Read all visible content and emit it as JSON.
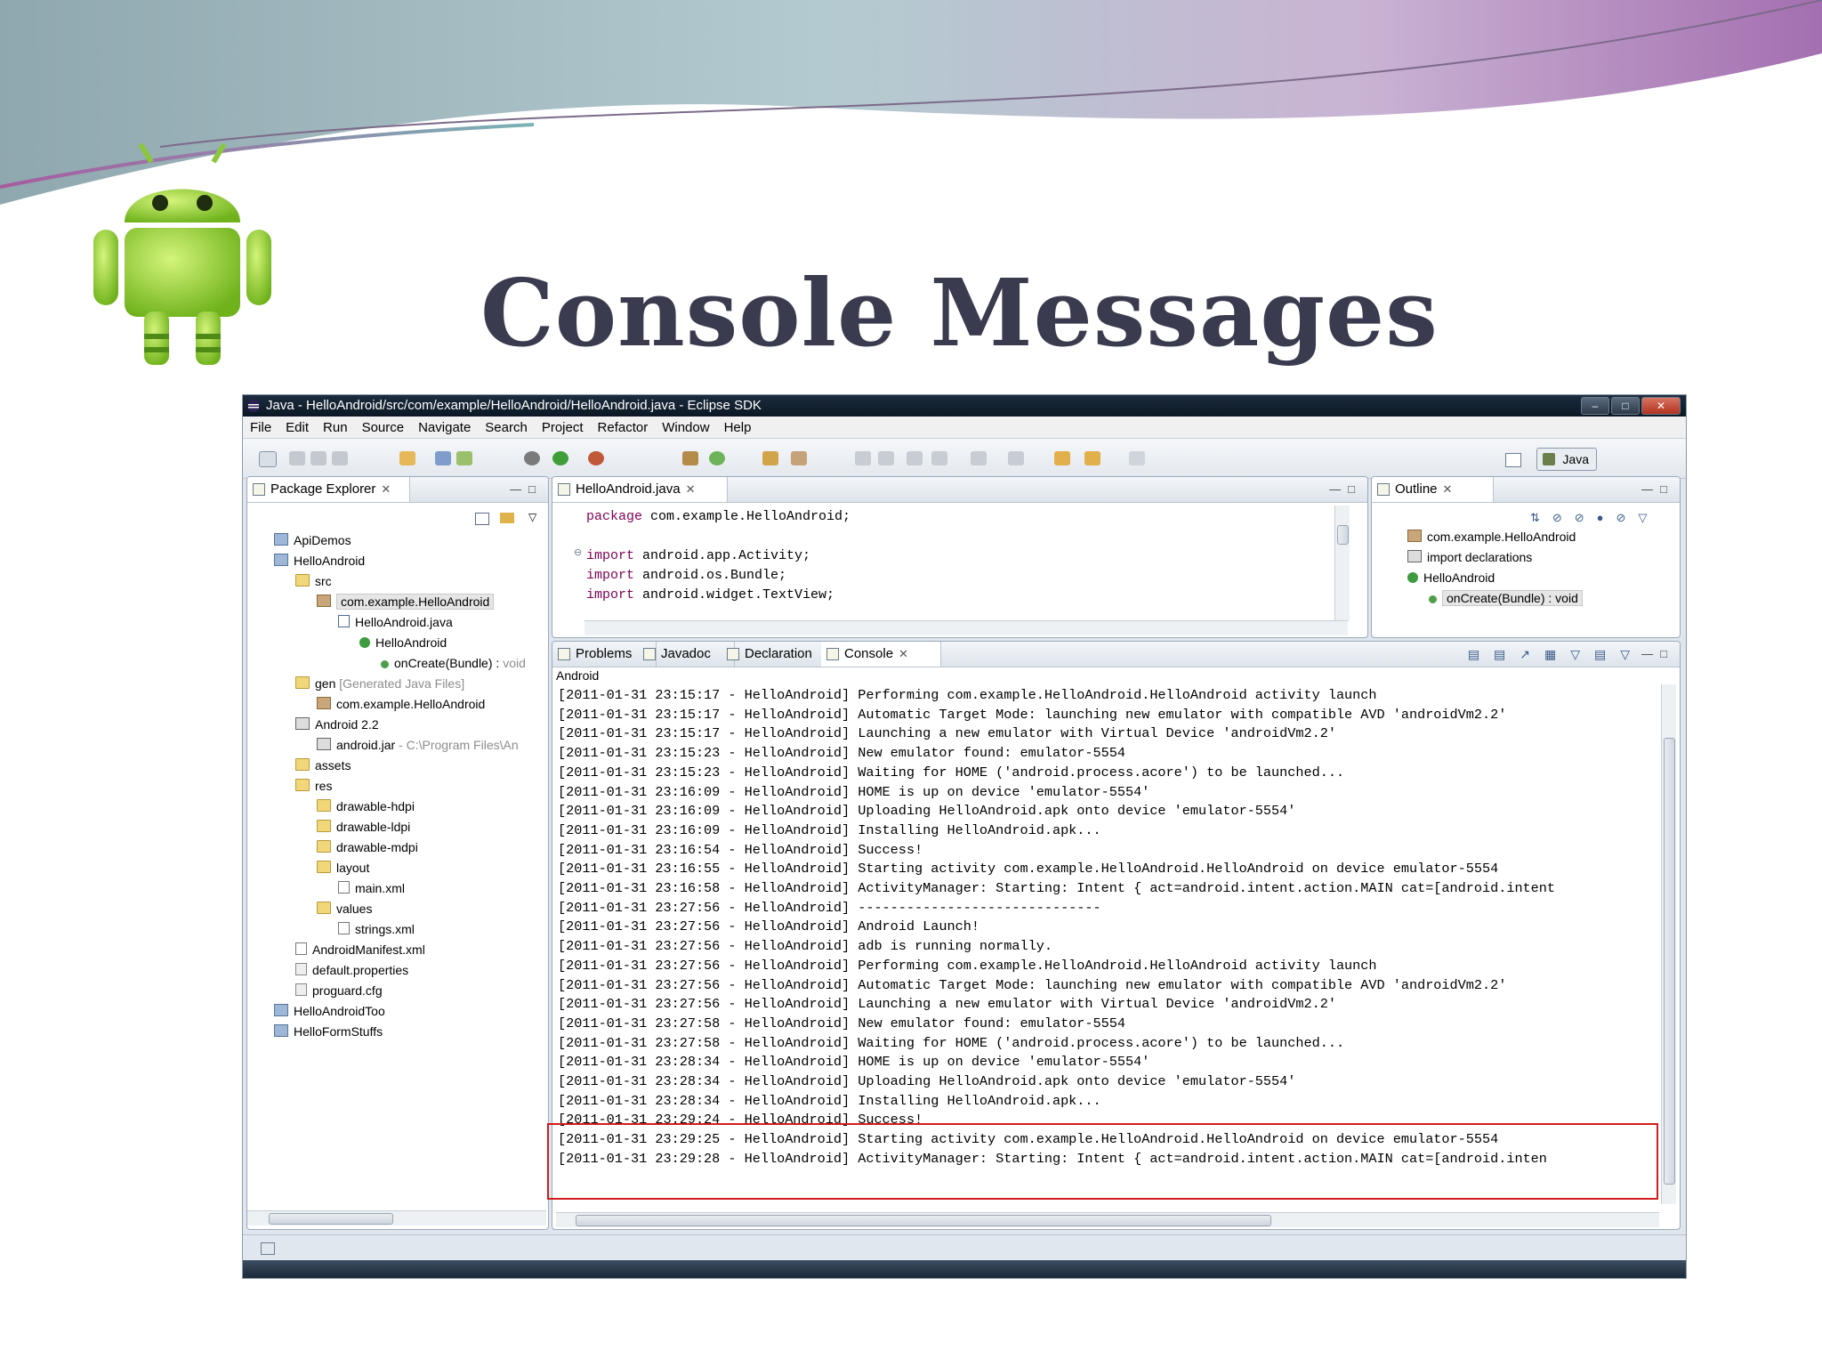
{
  "slide": {
    "title": "Console Messages"
  },
  "colors": {
    "title": "#3b3b4f",
    "highlight": "#d21c1c",
    "keyword": "#7f0055"
  },
  "window": {
    "title": "Java - HelloAndroid/src/com/example/HelloAndroid/HelloAndroid.java - Eclipse SDK",
    "menu": [
      "File",
      "Edit",
      "Run",
      "Source",
      "Navigate",
      "Search",
      "Project",
      "Refactor",
      "Window",
      "Help"
    ],
    "perspective": "Java"
  },
  "package_explorer": {
    "tab": "Package Explorer",
    "items": [
      {
        "label": "ApiDemos",
        "extra": "",
        "icon": "project-icon"
      },
      {
        "label": "HelloAndroid",
        "extra": "",
        "icon": "project-icon"
      },
      {
        "label": "src",
        "extra": "",
        "icon": "folder-icon"
      },
      {
        "label": "com.example.HelloAndroid",
        "extra": "",
        "icon": "package-icon"
      },
      {
        "label": "HelloAndroid.java",
        "extra": "",
        "icon": "java-file-icon"
      },
      {
        "label": "HelloAndroid",
        "extra": "",
        "icon": "class-icon"
      },
      {
        "label": "onCreate(Bundle) : ",
        "extra": "void",
        "icon": "method-icon"
      },
      {
        "label": "gen ",
        "extra": "[Generated Java Files]",
        "icon": "folder-icon"
      },
      {
        "label": "com.example.HelloAndroid",
        "extra": "",
        "icon": "package-icon"
      },
      {
        "label": "Android 2.2",
        "extra": "",
        "icon": "library-icon"
      },
      {
        "label": "android.jar",
        "extra": " - C:\\Program Files\\An",
        "icon": "jar-icon"
      },
      {
        "label": "assets",
        "extra": "",
        "icon": "folder-icon"
      },
      {
        "label": "res",
        "extra": "",
        "icon": "folder-icon"
      },
      {
        "label": "drawable-hdpi",
        "extra": "",
        "icon": "folder-icon"
      },
      {
        "label": "drawable-ldpi",
        "extra": "",
        "icon": "folder-icon"
      },
      {
        "label": "drawable-mdpi",
        "extra": "",
        "icon": "folder-icon"
      },
      {
        "label": "layout",
        "extra": "",
        "icon": "folder-icon"
      },
      {
        "label": "main.xml",
        "extra": "",
        "icon": "xml-file-icon"
      },
      {
        "label": "values",
        "extra": "",
        "icon": "folder-icon"
      },
      {
        "label": "strings.xml",
        "extra": "",
        "icon": "xml-file-icon"
      },
      {
        "label": "AndroidManifest.xml",
        "extra": "",
        "icon": "xml-file-icon"
      },
      {
        "label": "default.properties",
        "extra": "",
        "icon": "properties-file-icon"
      },
      {
        "label": "proguard.cfg",
        "extra": "",
        "icon": "properties-file-icon"
      },
      {
        "label": "HelloAndroidToo",
        "extra": "",
        "icon": "project-icon"
      },
      {
        "label": "HelloFormStuffs",
        "extra": "",
        "icon": "project-icon"
      }
    ]
  },
  "editor": {
    "tab": "HelloAndroid.java",
    "lines": [
      {
        "kw": "package",
        "rest": " com.example.HelloAndroid;"
      },
      {
        "kw": "",
        "rest": ""
      },
      {
        "kw": "import",
        "rest": " android.app.Activity;"
      },
      {
        "kw": "import",
        "rest": " android.os.Bundle;"
      },
      {
        "kw": "import",
        "rest": " android.widget.TextView;"
      }
    ]
  },
  "outline": {
    "tab": "Outline",
    "items": [
      {
        "label": "com.example.HelloAndroid"
      },
      {
        "label": "import declarations"
      },
      {
        "label": "HelloAndroid"
      },
      {
        "label": "onCreate(Bundle) : void"
      }
    ]
  },
  "console": {
    "tabs": [
      "Problems",
      "Javadoc",
      "Declaration",
      "Console"
    ],
    "name": "Android",
    "lines": [
      "[2011-01-31 23:15:17 - HelloAndroid] Performing com.example.HelloAndroid.HelloAndroid activity launch",
      "[2011-01-31 23:15:17 - HelloAndroid] Automatic Target Mode: launching new emulator with compatible AVD 'androidVm2.2'",
      "[2011-01-31 23:15:17 - HelloAndroid] Launching a new emulator with Virtual Device 'androidVm2.2'",
      "[2011-01-31 23:15:23 - HelloAndroid] New emulator found: emulator-5554",
      "[2011-01-31 23:15:23 - HelloAndroid] Waiting for HOME ('android.process.acore') to be launched...",
      "[2011-01-31 23:16:09 - HelloAndroid] HOME is up on device 'emulator-5554'",
      "[2011-01-31 23:16:09 - HelloAndroid] Uploading HelloAndroid.apk onto device 'emulator-5554'",
      "[2011-01-31 23:16:09 - HelloAndroid] Installing HelloAndroid.apk...",
      "[2011-01-31 23:16:54 - HelloAndroid] Success!",
      "[2011-01-31 23:16:55 - HelloAndroid] Starting activity com.example.HelloAndroid.HelloAndroid on device emulator-5554",
      "[2011-01-31 23:16:58 - HelloAndroid] ActivityManager: Starting: Intent { act=android.intent.action.MAIN cat=[android.intent",
      "[2011-01-31 23:27:56 - HelloAndroid] ------------------------------",
      "[2011-01-31 23:27:56 - HelloAndroid] Android Launch!",
      "[2011-01-31 23:27:56 - HelloAndroid] adb is running normally.",
      "[2011-01-31 23:27:56 - HelloAndroid] Performing com.example.HelloAndroid.HelloAndroid activity launch",
      "[2011-01-31 23:27:56 - HelloAndroid] Automatic Target Mode: launching new emulator with compatible AVD 'androidVm2.2'",
      "[2011-01-31 23:27:56 - HelloAndroid] Launching a new emulator with Virtual Device 'androidVm2.2'",
      "[2011-01-31 23:27:58 - HelloAndroid] New emulator found: emulator-5554",
      "[2011-01-31 23:27:58 - HelloAndroid] Waiting for HOME ('android.process.acore') to be launched...",
      "[2011-01-31 23:28:34 - HelloAndroid] HOME is up on device 'emulator-5554'",
      "[2011-01-31 23:28:34 - HelloAndroid] Uploading HelloAndroid.apk onto device 'emulator-5554'",
      "[2011-01-31 23:28:34 - HelloAndroid] Installing HelloAndroid.apk...",
      "[2011-01-31 23:29:24 - HelloAndroid] Success!",
      "[2011-01-31 23:29:25 - HelloAndroid] Starting activity com.example.HelloAndroid.HelloAndroid on device emulator-5554",
      "[2011-01-31 23:29:28 - HelloAndroid] ActivityManager: Starting: Intent { act=android.intent.action.MAIN cat=[android.inten"
    ]
  }
}
